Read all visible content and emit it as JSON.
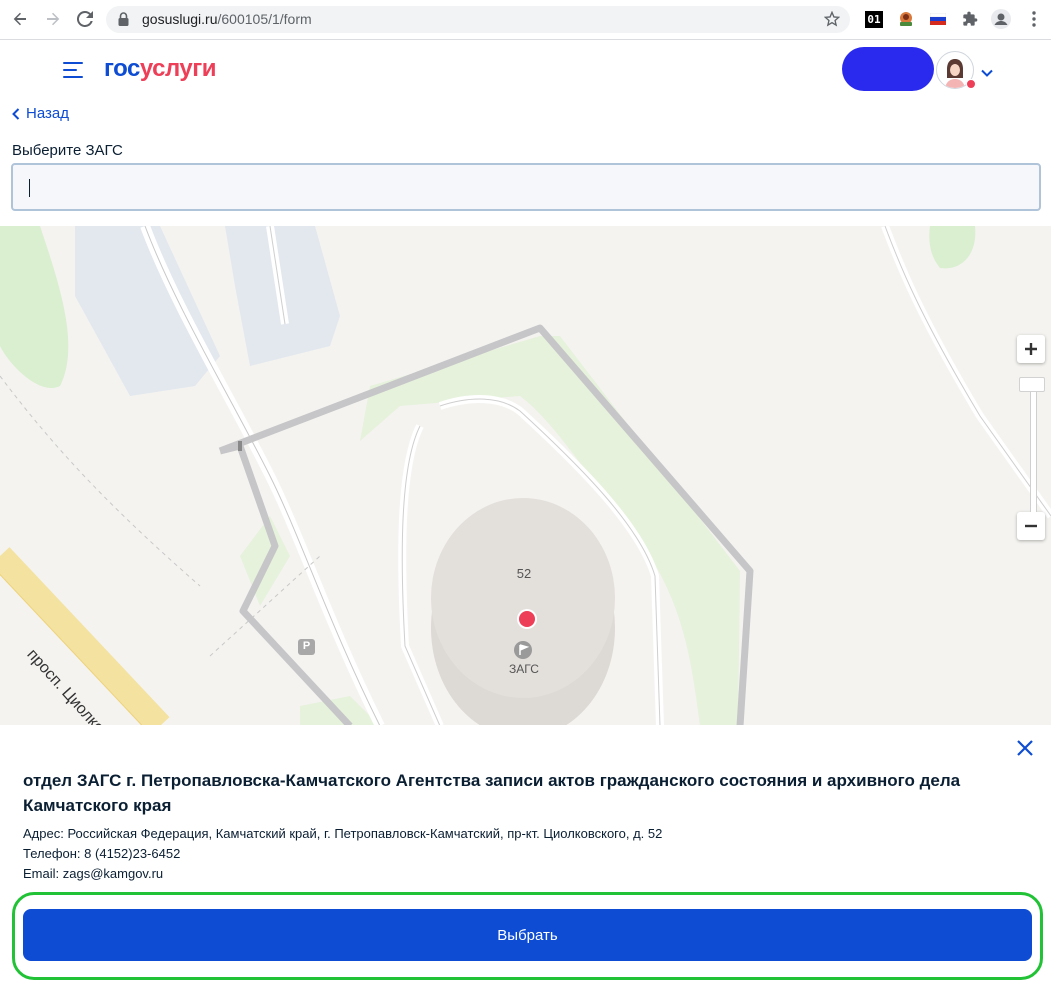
{
  "browser": {
    "url_domain": "gosuslugi.ru",
    "url_path": "/600105/1/form",
    "ext_label": "01"
  },
  "header": {
    "logo_part1": "гос",
    "logo_part2": "услуги"
  },
  "form": {
    "back_label": "Назад",
    "field_label": "Выберите ЗАГС",
    "field_value": ""
  },
  "map": {
    "building_number": "52",
    "poi_label": "ЗАГС",
    "street_label": "просп. Циолковско",
    "parking_label": "P"
  },
  "panel": {
    "title": "отдел ЗАГС г. Петропавловска-Камчатского Агентства записи актов гражданского состояния и архивного дела Камчатского края",
    "address_label": "Адрес:",
    "address_value": "Российская Федерация, Камчатский край, г. Петропавловск-Камчатский, пр-кт. Циолковского, д. 52",
    "phone_label": "Телефон:",
    "phone_value": "8 (4152)23-6452",
    "email_label": "Email:",
    "email_value": "zags@kamgov.ru",
    "select_button": "Выбрать"
  },
  "colors": {
    "brand_blue": "#0d4cd3",
    "brand_red": "#ee3f58",
    "highlight_green": "#22c236"
  }
}
